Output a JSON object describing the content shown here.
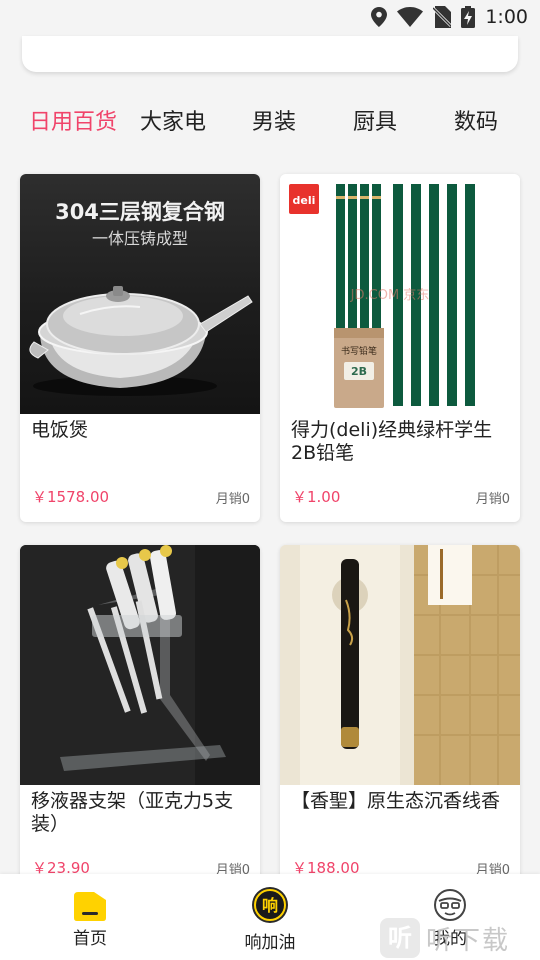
{
  "status_bar": {
    "time": "1:00"
  },
  "tabs": [
    {
      "label": "日用百货",
      "active": true
    },
    {
      "label": "大家电",
      "active": false
    },
    {
      "label": "男装",
      "active": false
    },
    {
      "label": "厨具",
      "active": false
    },
    {
      "label": "数码",
      "active": false
    }
  ],
  "products": [
    {
      "title": "电饭煲",
      "price": "￥1578.00",
      "sales": "月销0",
      "image": {
        "headline": "304三层钢复合钢",
        "subline": "一体压铸成型"
      }
    },
    {
      "title": "得力(deli)经典绿杆学生2B铅笔",
      "price": "￥1.00",
      "sales": "月销0",
      "image": {
        "brand": "deli",
        "box_label": "书写铅笔",
        "grade": "2B",
        "overlay": "JD.COM 京东"
      }
    },
    {
      "title": "移液器支架（亚克力5支装）",
      "price": "￥23.90",
      "sales": "月销0",
      "image": {}
    },
    {
      "title": "【香聖】原生态沉香线香",
      "price": "￥188.00",
      "sales": "月销0",
      "image": {}
    }
  ],
  "bottom_nav": [
    {
      "label": "首页",
      "icon": "home-icon",
      "active": true
    },
    {
      "label": "响加油",
      "icon": "fuel-icon",
      "badge": "响",
      "active": false
    },
    {
      "label": "我的",
      "icon": "profile-icon",
      "active": false
    }
  ],
  "watermark": {
    "badge": "听",
    "text": "听下载"
  },
  "colors": {
    "accent": "#f0446a",
    "background": "#f4f4f4",
    "nav_yellow": "#ffd200"
  }
}
